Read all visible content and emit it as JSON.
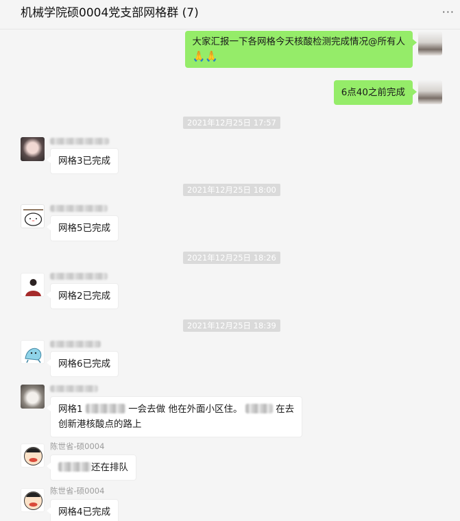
{
  "header": {
    "title": "机械学院硕0004党支部网格群 (7)",
    "more_icon": "···"
  },
  "messages": [
    {
      "text": "大家汇报一下各网格今天核酸检测完成情况@所有人",
      "emoji": "🙏🙏"
    },
    {
      "text": "6点40之前完成"
    },
    {
      "time": "2021年12月25日 17:57"
    },
    {
      "text": "网格3已完成"
    },
    {
      "time": "2021年12月25日 18:00"
    },
    {
      "text": "网格5已完成"
    },
    {
      "time": "2021年12月25日 18:26"
    },
    {
      "text": "网格2已完成"
    },
    {
      "time": "2021年12月25日 18:39"
    },
    {
      "text": "网格6已完成"
    },
    {
      "line1_a": "网格1",
      "line1_b": "一会去做 他在外面小区住。",
      "line1_c": "在去",
      "line2": "创新港核酸点的路上"
    },
    {
      "sender": "陈世省-硕0004",
      "text": "还在排队"
    },
    {
      "sender": "陈世省-硕0004",
      "text": "网格4已完成"
    }
  ]
}
